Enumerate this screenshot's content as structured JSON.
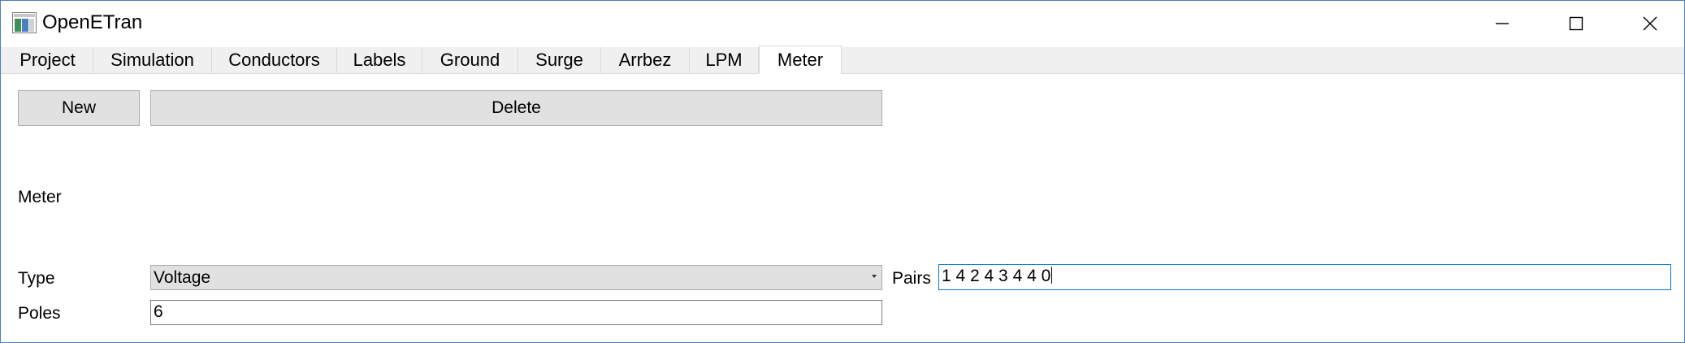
{
  "window": {
    "title": "OpenETran",
    "icon": "app-icon",
    "controls": [
      "minimize-icon",
      "maximize-icon",
      "close-icon"
    ]
  },
  "tabs": [
    {
      "label": "Project",
      "active": false
    },
    {
      "label": "Simulation",
      "active": false
    },
    {
      "label": "Conductors",
      "active": false
    },
    {
      "label": "Labels",
      "active": false
    },
    {
      "label": "Ground",
      "active": false
    },
    {
      "label": "Surge",
      "active": false
    },
    {
      "label": "Arrbez",
      "active": false
    },
    {
      "label": "LPM",
      "active": false
    },
    {
      "label": "Meter",
      "active": true
    }
  ],
  "toolbar": {
    "new_label": "New",
    "delete_label": "Delete"
  },
  "form": {
    "section_label": "Meter",
    "type_label": "Type",
    "type_value": "Voltage",
    "pairs_label": "Pairs",
    "pairs_value": "1 4 2 4 3 4 4 0",
    "poles_label": "Poles",
    "poles_value": "6"
  },
  "colors": {
    "window_border": "#4a7fc4",
    "tab_bar": "#f0f0f0",
    "button_face": "#e1e1e1",
    "focus_border": "#0078d7"
  }
}
